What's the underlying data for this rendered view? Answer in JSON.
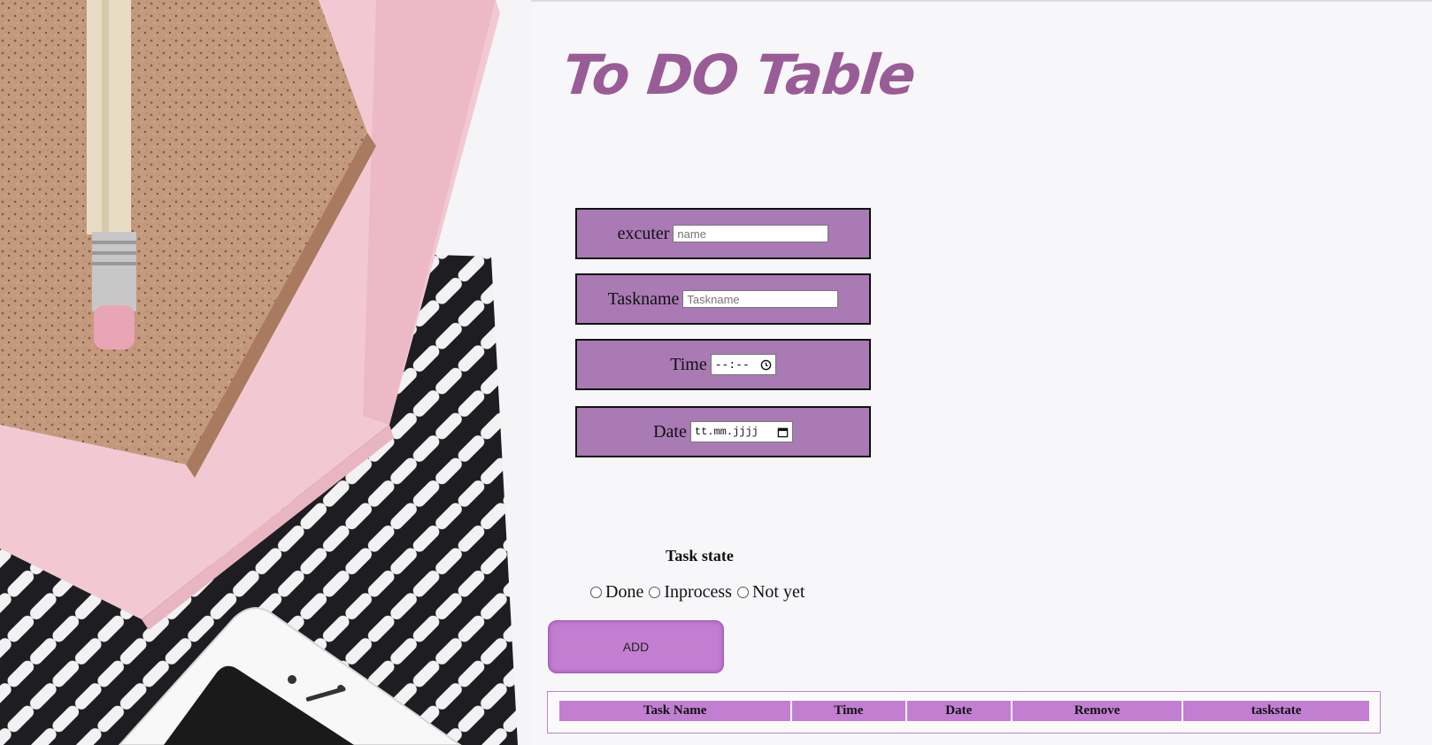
{
  "title": "To DO Table",
  "form": {
    "excuter_label": "excuter",
    "excuter_placeholder": "name",
    "taskname_label": "Taskname",
    "taskname_placeholder": "Taskname",
    "time_label": "Time",
    "time_value": "--:--",
    "date_label": "Date",
    "date_value": "tt.mm.jjjj"
  },
  "task_state": {
    "title": "Task state",
    "options": [
      "Done",
      "Inprocess",
      "Not yet"
    ]
  },
  "add_button": "ADD",
  "table": {
    "headers": [
      "Task Name",
      "Time",
      "Date",
      "Remove",
      "taskstate"
    ]
  },
  "colors": {
    "accent": "#c27fd2",
    "field_bg": "#a97ab4",
    "title": "#9a5c96"
  }
}
